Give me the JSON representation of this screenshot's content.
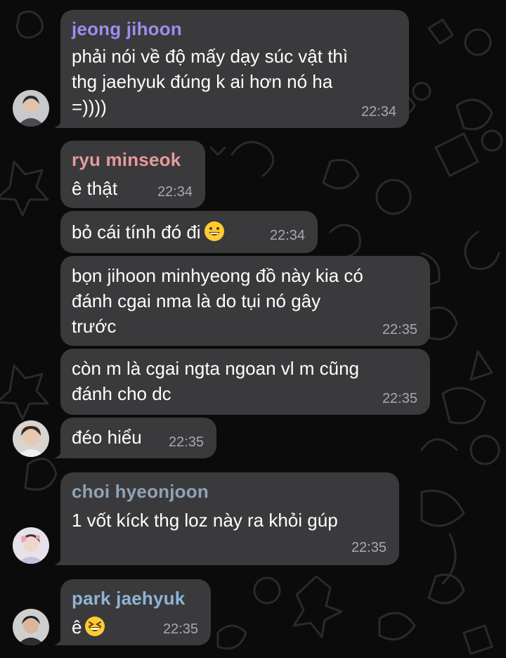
{
  "messages": [
    {
      "sender": "jeong jihoon",
      "sender_color": "#9b8ef0",
      "lines": [
        "phải nói về độ mấy dạy súc vật thì",
        "thg jaehyuk đúng k ai hơn nó ha",
        "=))))"
      ],
      "time": "22:34"
    },
    {
      "sender": "ryu minseok",
      "sender_color": "#e89a9a",
      "lines": [
        "ê thật"
      ],
      "time": "22:34"
    },
    {
      "lines": [
        "bỏ cái tính đó đi"
      ],
      "emoji": "grinning-face",
      "time": "22:34"
    },
    {
      "lines": [
        "bọn jihoon minhyeong đồ này kia có",
        "đánh cgai nma là do tụi nó gây",
        "trước"
      ],
      "time": "22:35"
    },
    {
      "lines": [
        "còn m là cgai ngta ngoan vl m cũng",
        "đánh cho dc"
      ],
      "time": "22:35"
    },
    {
      "lines": [
        "đéo hiểu"
      ],
      "time": "22:35"
    },
    {
      "sender": "choi hyeonjoon",
      "sender_color": "#8fa3b8",
      "lines": [
        "1 vốt kíck thg loz này ra khỏi gúp"
      ],
      "time": "22:35"
    },
    {
      "sender": "park jaehyuk",
      "sender_color": "#8fb4d6",
      "lines": [
        "ê"
      ],
      "emoji": "grinning-squinting-face",
      "time": "22:35"
    }
  ]
}
